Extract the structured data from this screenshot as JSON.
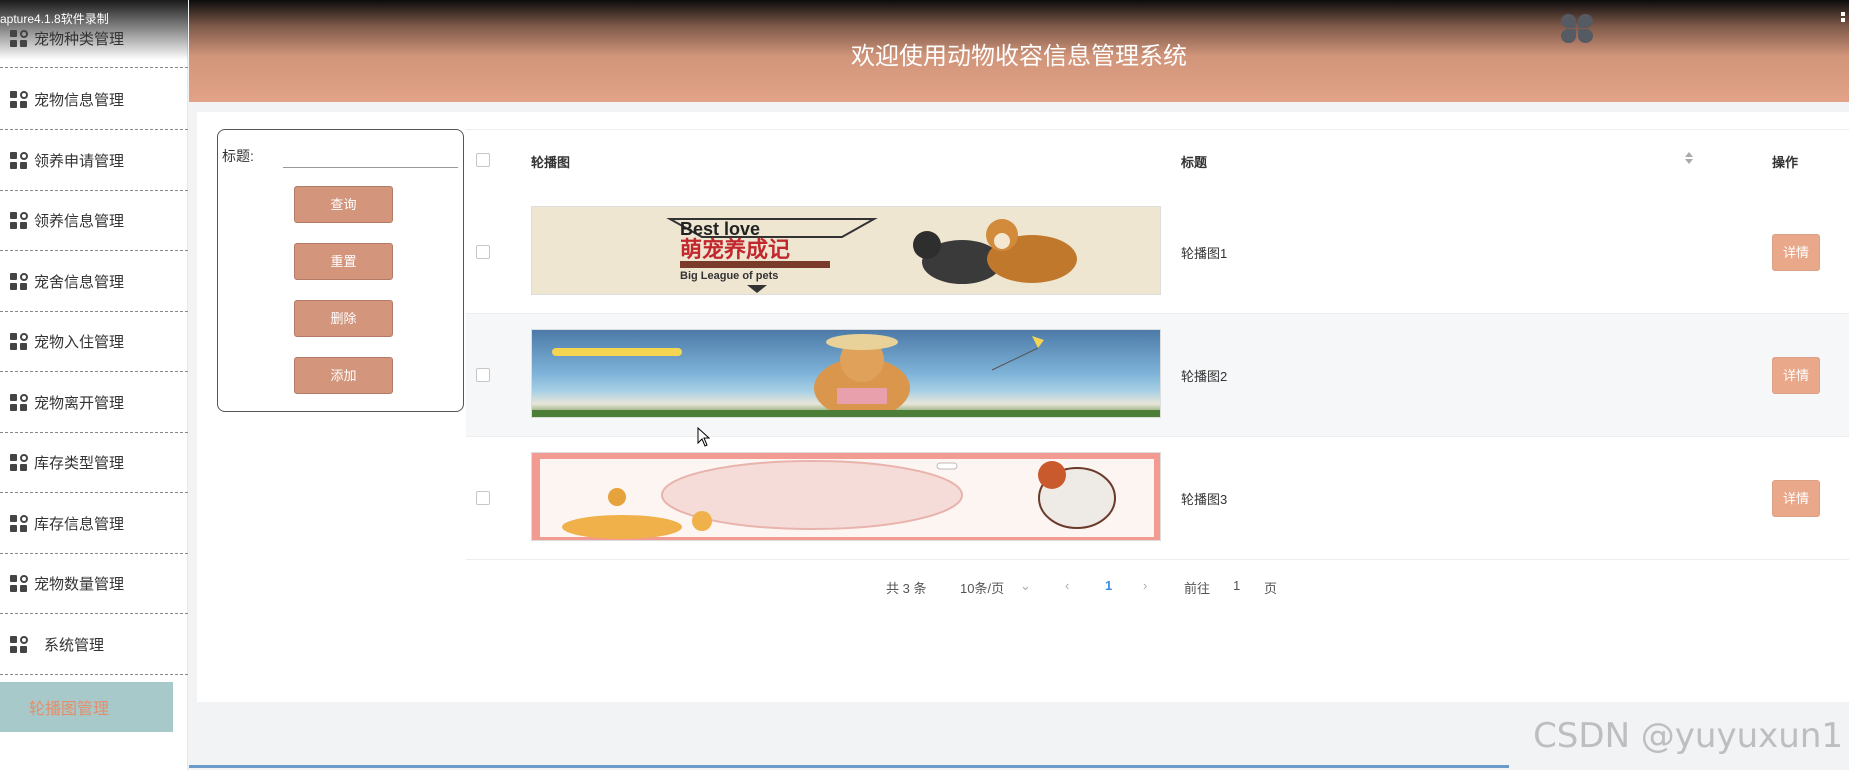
{
  "recording_label": "apture4.1.8软件录制",
  "header": {
    "title": "欢迎使用动物收容信息管理系统"
  },
  "sidebar": {
    "items": [
      {
        "label": "宠物种类管理"
      },
      {
        "label": "宠物信息管理"
      },
      {
        "label": "领养申请管理"
      },
      {
        "label": "领养信息管理"
      },
      {
        "label": "宠舍信息管理"
      },
      {
        "label": "宠物入住管理"
      },
      {
        "label": "宠物离开管理"
      },
      {
        "label": "库存类型管理"
      },
      {
        "label": "库存信息管理"
      },
      {
        "label": "宠物数量管理"
      },
      {
        "label": "系统管理"
      }
    ],
    "active": {
      "label": "轮播图管理"
    }
  },
  "search": {
    "label": "标题:",
    "value": "",
    "buttons": {
      "query": "查询",
      "reset": "重置",
      "delete": "删除",
      "add": "添加"
    }
  },
  "table": {
    "headers": {
      "image": "轮播图",
      "title": "标题",
      "action": "操作"
    },
    "rows": [
      {
        "title": "轮播图1",
        "action": "详情",
        "banner_text": [
          "Best love",
          "萌宠养成记",
          "Big League of pets"
        ]
      },
      {
        "title": "轮播图2",
        "action": "详情"
      },
      {
        "title": "轮播图3",
        "action": "详情"
      }
    ]
  },
  "pager": {
    "total": "共 3 条",
    "page_size": "10条/页",
    "current": "1",
    "goto_prefix": "前往",
    "goto_value": "1",
    "goto_suffix": "页"
  },
  "watermark": "CSDN @yuyuxun1",
  "colors": {
    "accent": "#d3957c",
    "detail_button": "#e8a889",
    "active_menu_bg": "#a8c9c9",
    "active_menu_text": "#e58d6a",
    "pager_active": "#3a8ee6"
  }
}
